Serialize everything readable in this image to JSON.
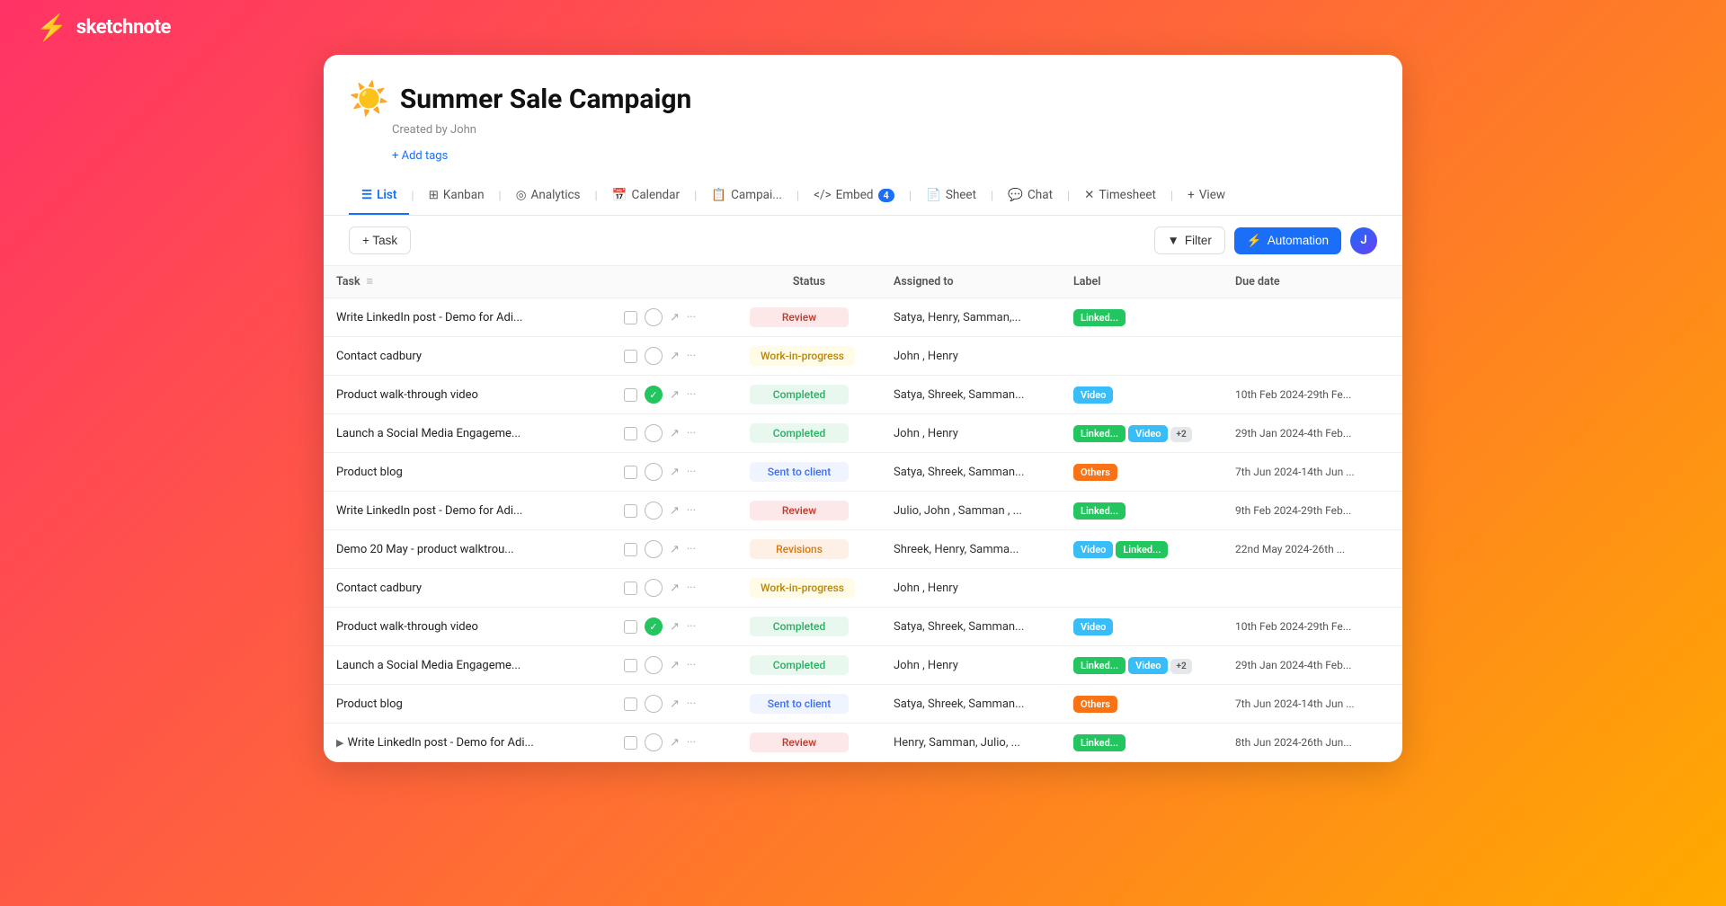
{
  "logo": {
    "icon": "⚡",
    "text": "sketchnote"
  },
  "page": {
    "emoji": "☀️",
    "title": "Summer Sale Campaign",
    "created_by": "Created by John",
    "add_tags_label": "+ Add tags"
  },
  "tabs": [
    {
      "id": "list",
      "icon": "☰",
      "label": "List",
      "active": true
    },
    {
      "id": "kanban",
      "icon": "⊞",
      "label": "Kanban",
      "active": false
    },
    {
      "id": "analytics",
      "icon": "◎",
      "label": "Analytics",
      "active": false
    },
    {
      "id": "calendar",
      "icon": "📅",
      "label": "Calendar",
      "active": false
    },
    {
      "id": "campai",
      "icon": "📋",
      "label": "Campai...",
      "active": false
    },
    {
      "id": "embed",
      "icon": "<>",
      "label": "Embed",
      "badge": "4",
      "active": false
    },
    {
      "id": "sheet",
      "icon": "📄",
      "label": "Sheet",
      "active": false
    },
    {
      "id": "chat",
      "icon": "💬",
      "label": "Chat",
      "active": false
    },
    {
      "id": "timesheet",
      "icon": "✕",
      "label": "Timesheet",
      "active": false
    },
    {
      "id": "view",
      "icon": "+",
      "label": "View",
      "active": false
    }
  ],
  "toolbar": {
    "add_task_label": "+ Task",
    "filter_label": "Filter",
    "automation_label": "Automation"
  },
  "table": {
    "columns": [
      {
        "id": "task",
        "label": "Task"
      },
      {
        "id": "status",
        "label": "Status"
      },
      {
        "id": "assigned",
        "label": "Assigned to"
      },
      {
        "id": "label",
        "label": "Label"
      },
      {
        "id": "due",
        "label": "Due date"
      }
    ],
    "rows": [
      {
        "id": 1,
        "task": "Write LinkedIn post - Demo for Adi...",
        "checked": false,
        "status": "Review",
        "status_type": "review",
        "assigned": "Satya, Henry, Samman,...",
        "labels": [
          {
            "type": "linked",
            "text": "Linked..."
          }
        ],
        "due": ""
      },
      {
        "id": 2,
        "task": "Contact cadbury",
        "checked": false,
        "status": "Work-in-progress",
        "status_type": "wip",
        "assigned": "John , Henry",
        "labels": [],
        "due": ""
      },
      {
        "id": 3,
        "task": "Product walk-through video",
        "checked": true,
        "status": "Completed",
        "status_type": "completed",
        "assigned": "Satya, Shreek, Samman...",
        "labels": [
          {
            "type": "video",
            "text": "Video"
          }
        ],
        "due": "10th Feb 2024-29th Fe..."
      },
      {
        "id": 4,
        "task": "Launch a Social Media Engageme...",
        "checked": false,
        "status": "Completed",
        "status_type": "completed",
        "assigned": "John , Henry",
        "labels": [
          {
            "type": "linked",
            "text": "Linked..."
          },
          {
            "type": "video",
            "text": "Video"
          },
          {
            "type": "plus",
            "text": "+2"
          }
        ],
        "due": "29th Jan 2024-4th Feb..."
      },
      {
        "id": 5,
        "task": "Product blog",
        "checked": false,
        "status": "Sent to client",
        "status_type": "sent",
        "assigned": "Satya, Shreek, Samman...",
        "labels": [
          {
            "type": "others",
            "text": "Others"
          }
        ],
        "due": "7th Jun 2024-14th Jun ..."
      },
      {
        "id": 6,
        "task": "Write LinkedIn post - Demo for Adi...",
        "checked": false,
        "status": "Review",
        "status_type": "review",
        "assigned": "Julio, John , Samman , ...",
        "labels": [
          {
            "type": "linked",
            "text": "Linked..."
          }
        ],
        "due": "9th Feb 2024-29th Feb..."
      },
      {
        "id": 7,
        "task": "Demo 20 May - product walktrou...",
        "checked": false,
        "status": "Revisions",
        "status_type": "revisions",
        "assigned": "Shreek, Henry, Samma...",
        "labels": [
          {
            "type": "video",
            "text": "Video"
          },
          {
            "type": "linked",
            "text": "Linked..."
          }
        ],
        "due": "22nd May 2024-26th ..."
      },
      {
        "id": 8,
        "task": "Contact cadbury",
        "checked": false,
        "status": "Work-in-progress",
        "status_type": "wip",
        "assigned": "John , Henry",
        "labels": [],
        "due": ""
      },
      {
        "id": 9,
        "task": "Product walk-through video",
        "checked": true,
        "status": "Completed",
        "status_type": "completed",
        "assigned": "Satya, Shreek, Samman...",
        "labels": [
          {
            "type": "video",
            "text": "Video"
          }
        ],
        "due": "10th Feb 2024-29th Fe..."
      },
      {
        "id": 10,
        "task": "Launch a Social Media Engageme...",
        "checked": false,
        "status": "Completed",
        "status_type": "completed",
        "assigned": "John , Henry",
        "labels": [
          {
            "type": "linked",
            "text": "Linked..."
          },
          {
            "type": "video",
            "text": "Video"
          },
          {
            "type": "plus",
            "text": "+2"
          }
        ],
        "due": "29th Jan 2024-4th Feb..."
      },
      {
        "id": 11,
        "task": "Product blog",
        "checked": false,
        "status": "Sent to client",
        "status_type": "sent",
        "assigned": "Satya, Shreek, Samman...",
        "labels": [
          {
            "type": "others",
            "text": "Others"
          }
        ],
        "due": "7th Jun 2024-14th Jun ..."
      },
      {
        "id": 12,
        "task": "Write LinkedIn post - Demo for Adi...",
        "checked": false,
        "expand": true,
        "status": "Review",
        "status_type": "review",
        "assigned": "Henry, Samman, Julio, ...",
        "labels": [
          {
            "type": "linked",
            "text": "Linked..."
          }
        ],
        "due": "8th Jun 2024-26th Jun..."
      }
    ]
  }
}
